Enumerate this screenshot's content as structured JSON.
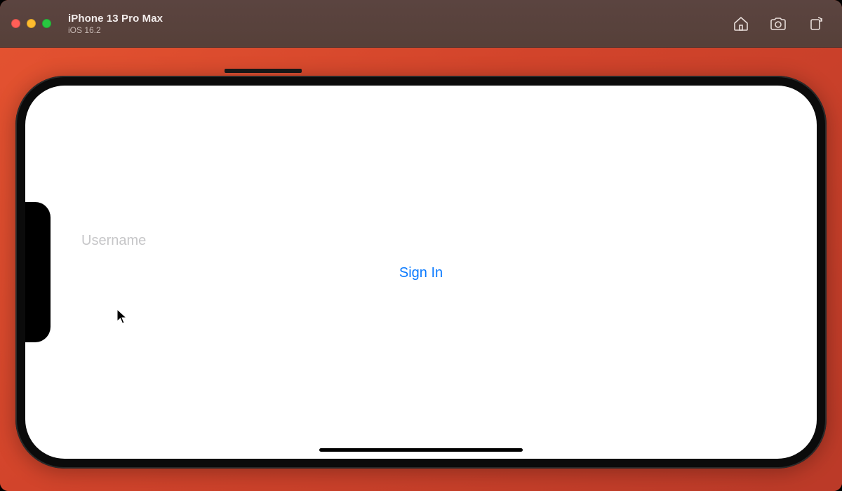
{
  "simulator": {
    "device_title": "iPhone 13 Pro Max",
    "os_subtitle": "iOS 16.2",
    "actions": {
      "home": "home-icon",
      "screenshot": "screenshot-icon",
      "rotate": "rotate-icon"
    }
  },
  "app": {
    "username_placeholder": "Username",
    "username_value": "",
    "signin_label": "Sign In"
  },
  "colors": {
    "link_blue": "#0a7aff",
    "placeholder_gray": "#c6c6c8",
    "desktop_orange": "#d2442b",
    "titlebar_brown": "#574039"
  }
}
